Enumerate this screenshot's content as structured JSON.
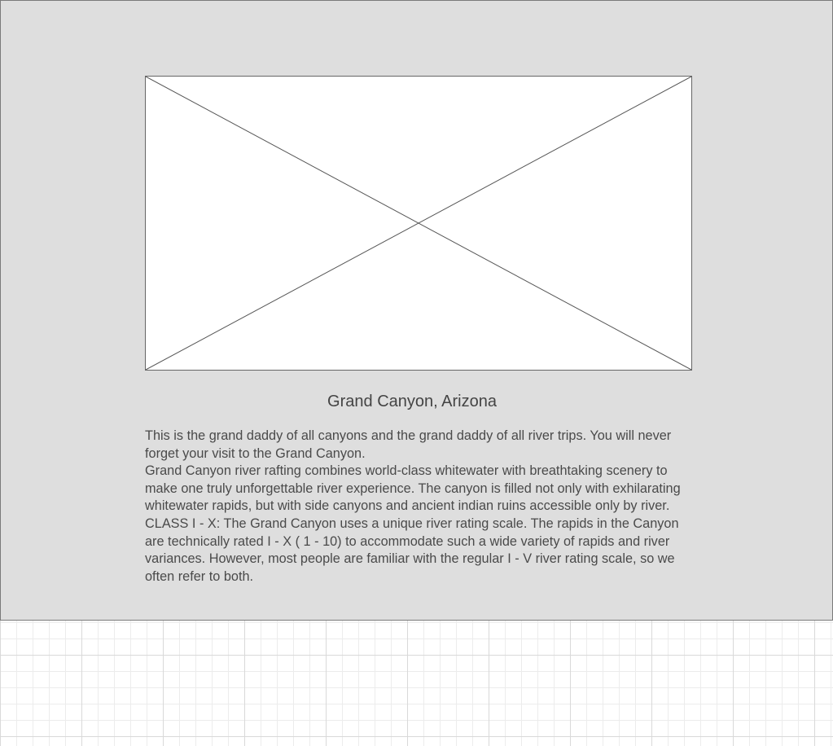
{
  "card": {
    "title": "Grand Canyon, Arizona",
    "paragraphs": [
      "This is the grand daddy of all canyons and the grand daddy of all river trips. You will never forget your visit to the Grand Canyon.",
      "Grand Canyon river rafting combines world-class whitewater with breathtaking scenery to make one truly unforgettable river experience. The canyon is filled not only with exhilarating whitewater rapids, but with side canyons and ancient indian ruins accessible only by river.",
      "CLASS I - X: The Grand Canyon uses a unique river rating scale. The rapids in the Canyon are technically rated I - X ( 1 - 10) to accommodate such a wide variety of rapids and river variances. However, most people are familiar with the regular I - V river rating scale, so we often refer to both."
    ]
  },
  "colors": {
    "panel_background": "#dedede",
    "text": "#4a4a4a",
    "placeholder_stroke": "#666666"
  }
}
